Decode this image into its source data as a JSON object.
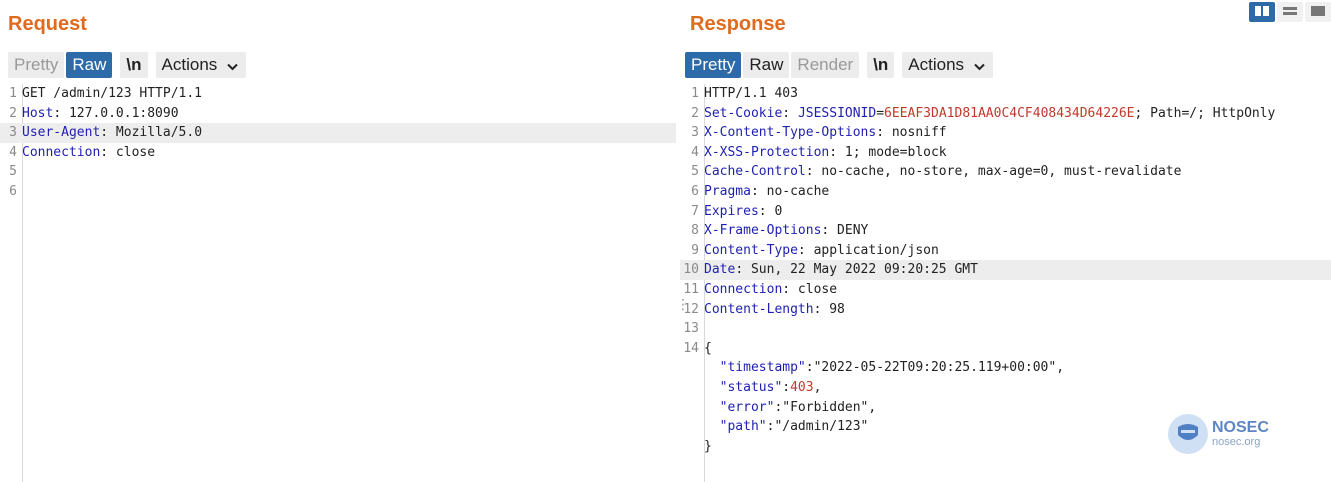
{
  "request": {
    "title": "Request",
    "toolbar": {
      "pretty": "Pretty",
      "raw": "Raw",
      "newline": "\\n",
      "actions": "Actions"
    },
    "lines": [
      {
        "n": "1",
        "code": "GET /admin/123 HTTP/1.1"
      },
      {
        "n": "2",
        "key": "Host",
        "val": ": 127.0.0.1:8090"
      },
      {
        "n": "3",
        "key": "User-Agent",
        "val": ": Mozilla/5.0"
      },
      {
        "n": "4",
        "key": "Connection",
        "val": ": close"
      },
      {
        "n": "5",
        "code": ""
      },
      {
        "n": "6",
        "code": ""
      }
    ]
  },
  "response": {
    "title": "Response",
    "toolbar": {
      "pretty": "Pretty",
      "raw": "Raw",
      "render": "Render",
      "newline": "\\n",
      "actions": "Actions"
    },
    "status_line": "HTTP/1.1 403",
    "set_cookie": {
      "key": "Set-Cookie",
      "sep": ": ",
      "name": "JSESSIONID",
      "eq": "=",
      "value": "6EEAF3DA1D81AA0C4CF408434D64226E",
      "rest": "; Path=/; HttpOnly"
    },
    "headers": [
      {
        "n": "3",
        "key": "X-Content-Type-Options",
        "val": ": nosniff"
      },
      {
        "n": "4",
        "key": "X-XSS-Protection",
        "val": ": 1; mode=block"
      },
      {
        "n": "5",
        "key": "Cache-Control",
        "val": ": no-cache, no-store, max-age=0, must-revalidate"
      },
      {
        "n": "6",
        "key": "Pragma",
        "val": ": no-cache"
      },
      {
        "n": "7",
        "key": "Expires",
        "val": ": 0"
      },
      {
        "n": "8",
        "key": "X-Frame-Options",
        "val": ": DENY"
      },
      {
        "n": "9",
        "key": "Content-Type",
        "val": ": application/json"
      },
      {
        "n": "10",
        "key": "Date",
        "val": ": Sun, 22 May 2022 09:20:25 GMT"
      },
      {
        "n": "11",
        "key": "Connection",
        "val": ": close"
      },
      {
        "n": "12",
        "key": "Content-Length",
        "val": ": 98"
      }
    ],
    "body": {
      "open": "{",
      "close": "}",
      "timestamp_key": "\"timestamp\"",
      "timestamp_val": "\"2022-05-22T09:20:25.119+00:00\",",
      "status_key": "\"status\"",
      "status_val": "403",
      "error_key": "\"error\"",
      "error_val": "\"Forbidden\",",
      "path_key": "\"path\"",
      "path_val": "\"/admin/123\""
    }
  },
  "watermark": {
    "name": "NOSEC",
    "url": "nosec.org"
  },
  "colors": {
    "accent": "#e06b1f",
    "active_button": "#2c6aa8",
    "key": "#1f1fb0",
    "value_red": "#c0392b"
  }
}
